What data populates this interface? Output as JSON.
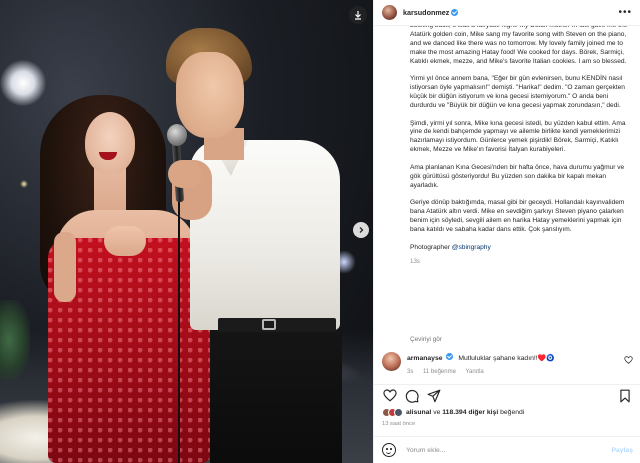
{
  "header": {
    "username": "karsudonmez",
    "verified": true
  },
  "caption": {
    "paragraphs": [
      "Looking back, it was a fairytale night. My Dutch mother-in-law gave me the Atatürk golden coin, Mike sang my favorite song with Steven on the piano, and we danced like there was no tomorrow. My lovely family joined me to make the most amazing Hatay food! We cooked for days. Börek, Sarmiçi, Katıklı ekmek, mezze, and Mike's favorite Italian cookies. I am so blessed.",
      "Yirmi yıl önce annem bana, \"Eğer bir gün evlenirsen, bunu KENDİN nasıl istiyorsan öyle yapmalısın!\" demişti. \"Harika!\" dedim. \"O zaman gerçekten küçük bir düğün istiyorum ve kına gecesi istemiyorum.\" O anda beni durdurdu ve \"Büyük bir düğün ve kına gecesi yapmak zorundasın,\" dedi.",
      "Şimdi, yirmi yıl sonra, Mike kına gecesi istedi, bu yüzden kabul ettim. Ama yine de kendi bahçemde yapmayı ve ailemle birlikte kendi yemeklerimizi hazırlamayı istiyordum. Günlerce yemek pişirdik! Börek, Sarmiçi, Katıklı ekmek, Mezze ve Mike'ın favorisi İtalyan kurabiyeleri.",
      "Ama planlanan Kına Gecesi'nden bir hafta önce, hava durumu yağmur ve gök gürültüsü gösteriyordu! Bu yüzden son dakika bir kapalı mekan ayarladık.",
      "Geriye dönüp baktığımda, masal gibi bir geceydi. Hollandalı kayınvalidem bana Atatürk altın verdi. Mike en sevdiğim şarkıyı Steven piyano çalarken benim için söyledi, sevgili ailem en harika Hatay yemeklerini yapmak için bana katıldı ve sabaha kadar dans ettik. Çok şanslıyım."
    ],
    "photographer_prefix": "Photographer ",
    "photographer_mention": "@sbingraphy",
    "time": "13s"
  },
  "translate_label": "Çeviriyi gör",
  "comment": {
    "username": "armanayse",
    "verified": true,
    "text": "Mutluluklar şahane kadın!!♥️🧿",
    "time": "3s",
    "likes": "11 beğenme",
    "reply": "Yanıtla"
  },
  "likes": {
    "prefix_user": "alisunal",
    "middle": " ve ",
    "count": "118.394 diğer kişi",
    "suffix": " beğendi"
  },
  "post_time": "13 saat önce",
  "add_comment": {
    "placeholder": "Yorum ekle...",
    "post_label": "Paylaş"
  },
  "icons": {
    "download": "download-icon",
    "next": "chevron-right-icon",
    "more": "more-horizontal-icon",
    "heart": "heart-icon",
    "comment": "comment-icon",
    "share": "send-icon",
    "save": "bookmark-icon",
    "emoji": "emoji-icon"
  },
  "colors": {
    "accent": "#0095f6",
    "verified": "#3897f0",
    "dress": "#b50e1c"
  }
}
